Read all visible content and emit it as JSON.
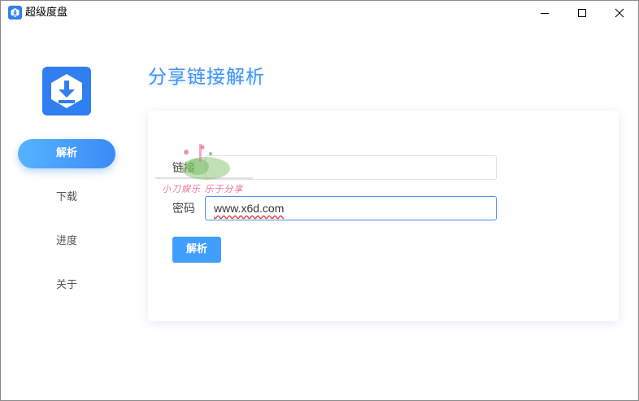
{
  "window": {
    "title": "超级度盘"
  },
  "sidebar": {
    "items": [
      {
        "label": "解析",
        "active": true
      },
      {
        "label": "下载",
        "active": false
      },
      {
        "label": "进度",
        "active": false
      },
      {
        "label": "关于",
        "active": false
      }
    ]
  },
  "main": {
    "title": "分享链接解析",
    "link_label": "链接",
    "link_value": "",
    "password_label": "密码",
    "password_value": "www.x6d.com",
    "submit_label": "解析"
  },
  "watermark": {
    "text": "小刀娱乐 乐于分享"
  },
  "colors": {
    "accent": "#409eff",
    "title": "#3f93f5",
    "logo": "#2f7ff0"
  }
}
